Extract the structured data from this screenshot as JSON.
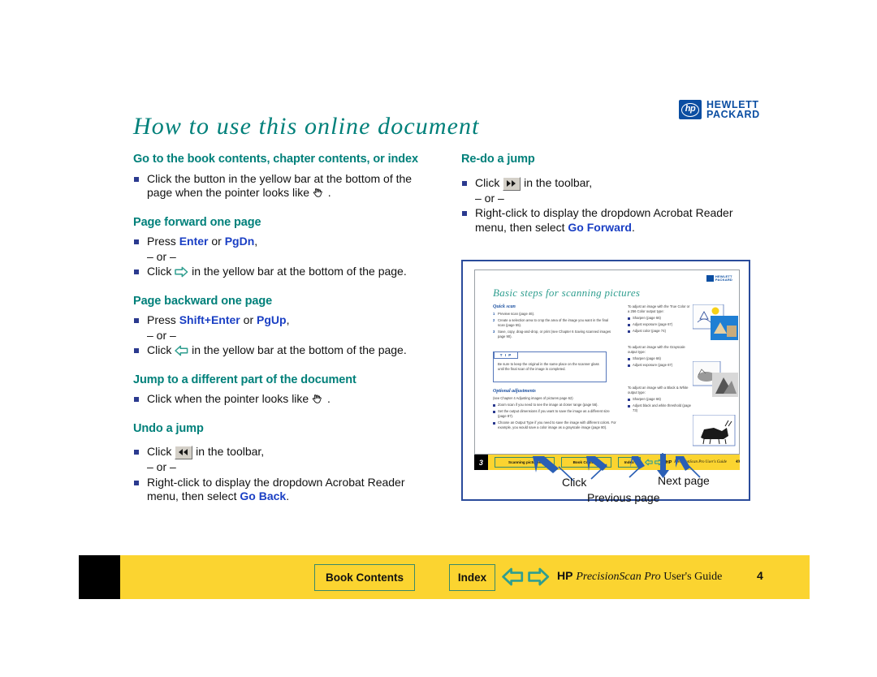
{
  "logo": {
    "mark_text": "hp",
    "line1": "HEWLETT",
    "line2": "PACKARD"
  },
  "title": "How to use this online document",
  "left_column": {
    "sections": [
      {
        "heading": "Go to the book contents, chapter contents, or index",
        "items": [
          {
            "type": "bullet",
            "text_before": "Click the button in the yellow bar at the bottom of the page when the pointer looks like ",
            "icon": "hand-pointer-icon",
            "text_after": " ."
          }
        ]
      },
      {
        "heading": "Page forward one page",
        "items": [
          {
            "type": "bullet",
            "text_before": "Press ",
            "kw1": "Enter",
            "mid": " or ",
            "kw2": "PgDn",
            "text_after": ","
          },
          {
            "type": "or",
            "text": "– or –"
          },
          {
            "type": "bullet",
            "text_before": "Click ",
            "icon": "arrow-right-icon",
            "text_after": " in the yellow bar at the bottom of the page."
          }
        ]
      },
      {
        "heading": "Page backward one page",
        "items": [
          {
            "type": "bullet",
            "text_before": "Press ",
            "kw1": "Shift+Enter",
            "mid": " or ",
            "kw2": "PgUp",
            "text_after": ","
          },
          {
            "type": "or",
            "text": "– or –"
          },
          {
            "type": "bullet",
            "text_before": "Click ",
            "icon": "arrow-left-icon",
            "text_after": " in the yellow bar at the bottom of the page."
          }
        ]
      },
      {
        "heading": "Jump to a different part of the document",
        "items": [
          {
            "type": "bullet",
            "text_before": "Click when the pointer looks like ",
            "icon": "hand-pointer-icon",
            "text_after": " ."
          }
        ]
      },
      {
        "heading": "Undo a jump",
        "items": [
          {
            "type": "bullet",
            "text_before": "Click ",
            "icon": "go-back-toolbar-icon",
            "text_after": " in the toolbar,"
          },
          {
            "type": "or",
            "text": "– or –"
          },
          {
            "type": "bullet",
            "text_before": "Right-click to display the dropdown Acrobat Reader menu, then select ",
            "kw1": "Go Back",
            "text_after": "."
          }
        ]
      }
    ]
  },
  "right_column": {
    "sections": [
      {
        "heading": "Re-do a jump",
        "items": [
          {
            "type": "bullet",
            "text_before": "Click ",
            "icon": "go-forward-toolbar-icon",
            "text_after": " in the toolbar,"
          },
          {
            "type": "or",
            "text": "– or –"
          },
          {
            "type": "bullet",
            "text_before": "Right-click to display the dropdown Acrobat Reader menu, then select ",
            "kw1": "Go Forward",
            "text_after": "."
          }
        ]
      }
    ]
  },
  "illustration": {
    "mini_page": {
      "logo_line1": "HEWLETT",
      "logo_line2": "PACKARD",
      "title": "Basic steps for scanning pictures",
      "quick_scan_heading": "Quick scan",
      "quick_scan_steps": [
        {
          "n": "1",
          "text": "Preview scan (page 46)."
        },
        {
          "n": "2",
          "text": "Create a selection area to crop the area of the image you want in the final scan (page 55)."
        },
        {
          "n": "3",
          "text": "Save, copy, drag-and-drop, or print (see Chapter 6 Saving scanned images page 90)."
        }
      ],
      "tip_label": "T I P",
      "tip_text": "Be sure to keep the original in the same place on the scanner glass until the final scan of the image is completed.",
      "optional_heading": "Optional adjustments",
      "optional_intro": "(see Chapter 4 Adjusting images of pictures page 62)",
      "optional_items": [
        "Zoom scan if you need to see the image at closer range (page 56).",
        "Set the output dimensions if you want to save the image as a different size (page 87).",
        "Choose an Output Type if you need to save the image with different colors. For example, you would save a color image as a grayscale image (page 80)."
      ],
      "right_groups": [
        {
          "intro": "To adjust an image with the True Color or a 256 Color output type:",
          "items": [
            "Sharpen (page 66)",
            "Adjust exposure (page 67)",
            "Adjust color (page 74)"
          ]
        },
        {
          "intro": "To adjust an image with the Grayscale output type:",
          "items": [
            "Sharpen (page 66)",
            "Adjust exposure (page 67)"
          ]
        },
        {
          "intro": "To adjust an image with a Black & White output type:",
          "items": [
            "Sharpen (page 66)",
            "Adjust black and white threshold (page 73)"
          ]
        }
      ],
      "bar": {
        "chapter_number": "3",
        "buttons": [
          "Scanning pictures",
          "Book Contents",
          "Index"
        ],
        "hp_bold": "HP",
        "guide_italic": "PrecisionScan Pro User's Guide",
        "page_number": "49"
      }
    },
    "callouts": [
      {
        "label": "Click"
      },
      {
        "label": "Previous page"
      },
      {
        "label": "Next page"
      }
    ]
  },
  "footer": {
    "book_contents_label": "Book Contents",
    "index_label": "Index",
    "prev_icon": "arrow-left-icon",
    "next_icon": "arrow-right-icon",
    "hp_bold": "HP",
    "guide_italic": "PrecisionScan Pro",
    "guide_rest": " User's Guide",
    "page_number": "4"
  },
  "colors": {
    "heading_teal": "#00807a",
    "keyword_blue": "#1a3fc4",
    "bullet_navy": "#2b3a8f",
    "bar_yellow": "#fbd430",
    "arrow_teal": "#2f9e8f",
    "hp_blue": "#0b4ea2",
    "illus_border": "#2a4b9b"
  }
}
